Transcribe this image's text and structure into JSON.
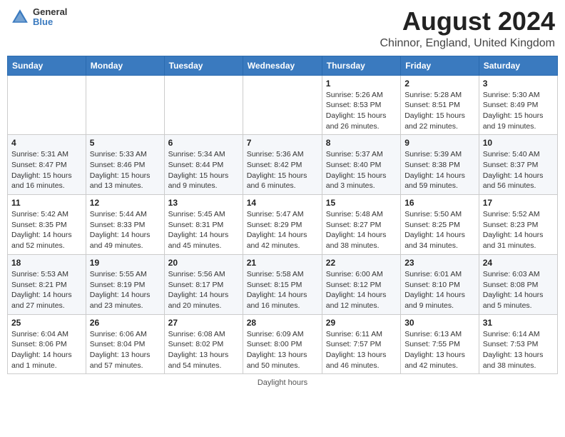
{
  "header": {
    "logo_line1": "General",
    "logo_line2": "Blue",
    "month": "August 2024",
    "location": "Chinnor, England, United Kingdom"
  },
  "days_of_week": [
    "Sunday",
    "Monday",
    "Tuesday",
    "Wednesday",
    "Thursday",
    "Friday",
    "Saturday"
  ],
  "weeks": [
    [
      {
        "day": "",
        "info": ""
      },
      {
        "day": "",
        "info": ""
      },
      {
        "day": "",
        "info": ""
      },
      {
        "day": "",
        "info": ""
      },
      {
        "day": "1",
        "info": "Sunrise: 5:26 AM\nSunset: 8:53 PM\nDaylight: 15 hours\nand 26 minutes."
      },
      {
        "day": "2",
        "info": "Sunrise: 5:28 AM\nSunset: 8:51 PM\nDaylight: 15 hours\nand 22 minutes."
      },
      {
        "day": "3",
        "info": "Sunrise: 5:30 AM\nSunset: 8:49 PM\nDaylight: 15 hours\nand 19 minutes."
      }
    ],
    [
      {
        "day": "4",
        "info": "Sunrise: 5:31 AM\nSunset: 8:47 PM\nDaylight: 15 hours\nand 16 minutes."
      },
      {
        "day": "5",
        "info": "Sunrise: 5:33 AM\nSunset: 8:46 PM\nDaylight: 15 hours\nand 13 minutes."
      },
      {
        "day": "6",
        "info": "Sunrise: 5:34 AM\nSunset: 8:44 PM\nDaylight: 15 hours\nand 9 minutes."
      },
      {
        "day": "7",
        "info": "Sunrise: 5:36 AM\nSunset: 8:42 PM\nDaylight: 15 hours\nand 6 minutes."
      },
      {
        "day": "8",
        "info": "Sunrise: 5:37 AM\nSunset: 8:40 PM\nDaylight: 15 hours\nand 3 minutes."
      },
      {
        "day": "9",
        "info": "Sunrise: 5:39 AM\nSunset: 8:38 PM\nDaylight: 14 hours\nand 59 minutes."
      },
      {
        "day": "10",
        "info": "Sunrise: 5:40 AM\nSunset: 8:37 PM\nDaylight: 14 hours\nand 56 minutes."
      }
    ],
    [
      {
        "day": "11",
        "info": "Sunrise: 5:42 AM\nSunset: 8:35 PM\nDaylight: 14 hours\nand 52 minutes."
      },
      {
        "day": "12",
        "info": "Sunrise: 5:44 AM\nSunset: 8:33 PM\nDaylight: 14 hours\nand 49 minutes."
      },
      {
        "day": "13",
        "info": "Sunrise: 5:45 AM\nSunset: 8:31 PM\nDaylight: 14 hours\nand 45 minutes."
      },
      {
        "day": "14",
        "info": "Sunrise: 5:47 AM\nSunset: 8:29 PM\nDaylight: 14 hours\nand 42 minutes."
      },
      {
        "day": "15",
        "info": "Sunrise: 5:48 AM\nSunset: 8:27 PM\nDaylight: 14 hours\nand 38 minutes."
      },
      {
        "day": "16",
        "info": "Sunrise: 5:50 AM\nSunset: 8:25 PM\nDaylight: 14 hours\nand 34 minutes."
      },
      {
        "day": "17",
        "info": "Sunrise: 5:52 AM\nSunset: 8:23 PM\nDaylight: 14 hours\nand 31 minutes."
      }
    ],
    [
      {
        "day": "18",
        "info": "Sunrise: 5:53 AM\nSunset: 8:21 PM\nDaylight: 14 hours\nand 27 minutes."
      },
      {
        "day": "19",
        "info": "Sunrise: 5:55 AM\nSunset: 8:19 PM\nDaylight: 14 hours\nand 23 minutes."
      },
      {
        "day": "20",
        "info": "Sunrise: 5:56 AM\nSunset: 8:17 PM\nDaylight: 14 hours\nand 20 minutes."
      },
      {
        "day": "21",
        "info": "Sunrise: 5:58 AM\nSunset: 8:15 PM\nDaylight: 14 hours\nand 16 minutes."
      },
      {
        "day": "22",
        "info": "Sunrise: 6:00 AM\nSunset: 8:12 PM\nDaylight: 14 hours\nand 12 minutes."
      },
      {
        "day": "23",
        "info": "Sunrise: 6:01 AM\nSunset: 8:10 PM\nDaylight: 14 hours\nand 9 minutes."
      },
      {
        "day": "24",
        "info": "Sunrise: 6:03 AM\nSunset: 8:08 PM\nDaylight: 14 hours\nand 5 minutes."
      }
    ],
    [
      {
        "day": "25",
        "info": "Sunrise: 6:04 AM\nSunset: 8:06 PM\nDaylight: 14 hours\nand 1 minute."
      },
      {
        "day": "26",
        "info": "Sunrise: 6:06 AM\nSunset: 8:04 PM\nDaylight: 13 hours\nand 57 minutes."
      },
      {
        "day": "27",
        "info": "Sunrise: 6:08 AM\nSunset: 8:02 PM\nDaylight: 13 hours\nand 54 minutes."
      },
      {
        "day": "28",
        "info": "Sunrise: 6:09 AM\nSunset: 8:00 PM\nDaylight: 13 hours\nand 50 minutes."
      },
      {
        "day": "29",
        "info": "Sunrise: 6:11 AM\nSunset: 7:57 PM\nDaylight: 13 hours\nand 46 minutes."
      },
      {
        "day": "30",
        "info": "Sunrise: 6:13 AM\nSunset: 7:55 PM\nDaylight: 13 hours\nand 42 minutes."
      },
      {
        "day": "31",
        "info": "Sunrise: 6:14 AM\nSunset: 7:53 PM\nDaylight: 13 hours\nand 38 minutes."
      }
    ]
  ],
  "footer": "Daylight hours"
}
